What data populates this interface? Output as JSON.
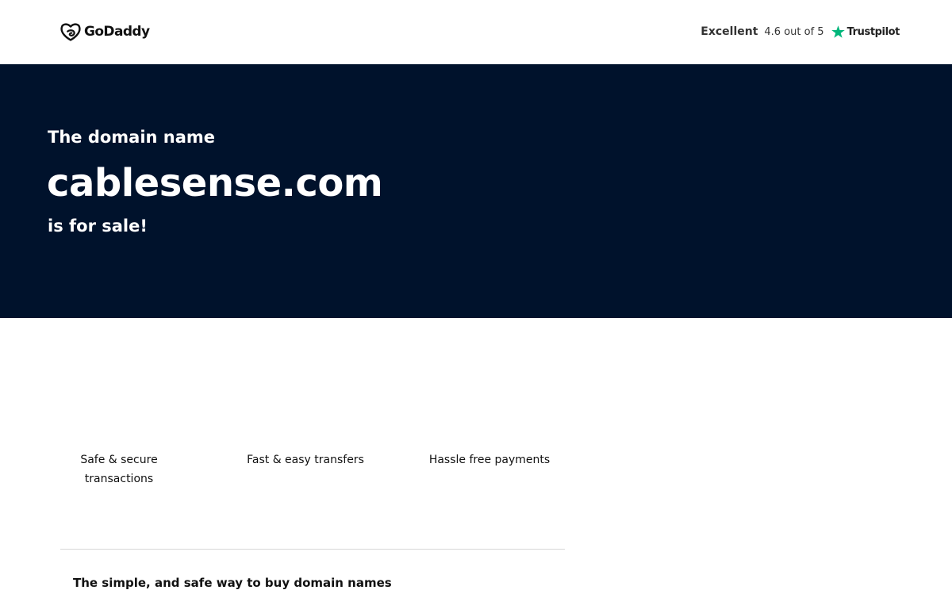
{
  "header": {
    "logo_text": "GoDaddy",
    "rating_label": "Excellent",
    "rating_score": "4.6 out of 5",
    "trustpilot_name": "Trustpilot"
  },
  "hero": {
    "pre": "The domain name",
    "domain": "cablesense.com",
    "post": "is for sale!"
  },
  "features": [
    {
      "label": "Safe & secure transactions"
    },
    {
      "label": "Fast & easy transfers"
    },
    {
      "label": "Hassle free payments"
    }
  ],
  "bottom": {
    "title": "The simple, and safe way to buy domain names"
  },
  "colors": {
    "hero_bg": "#00122c",
    "trustpilot_green": "#00b67a",
    "text_dark": "#111111"
  },
  "icons": {
    "logo": "godaddy-logo-icon",
    "rating_star": "trustpilot-star-icon"
  }
}
